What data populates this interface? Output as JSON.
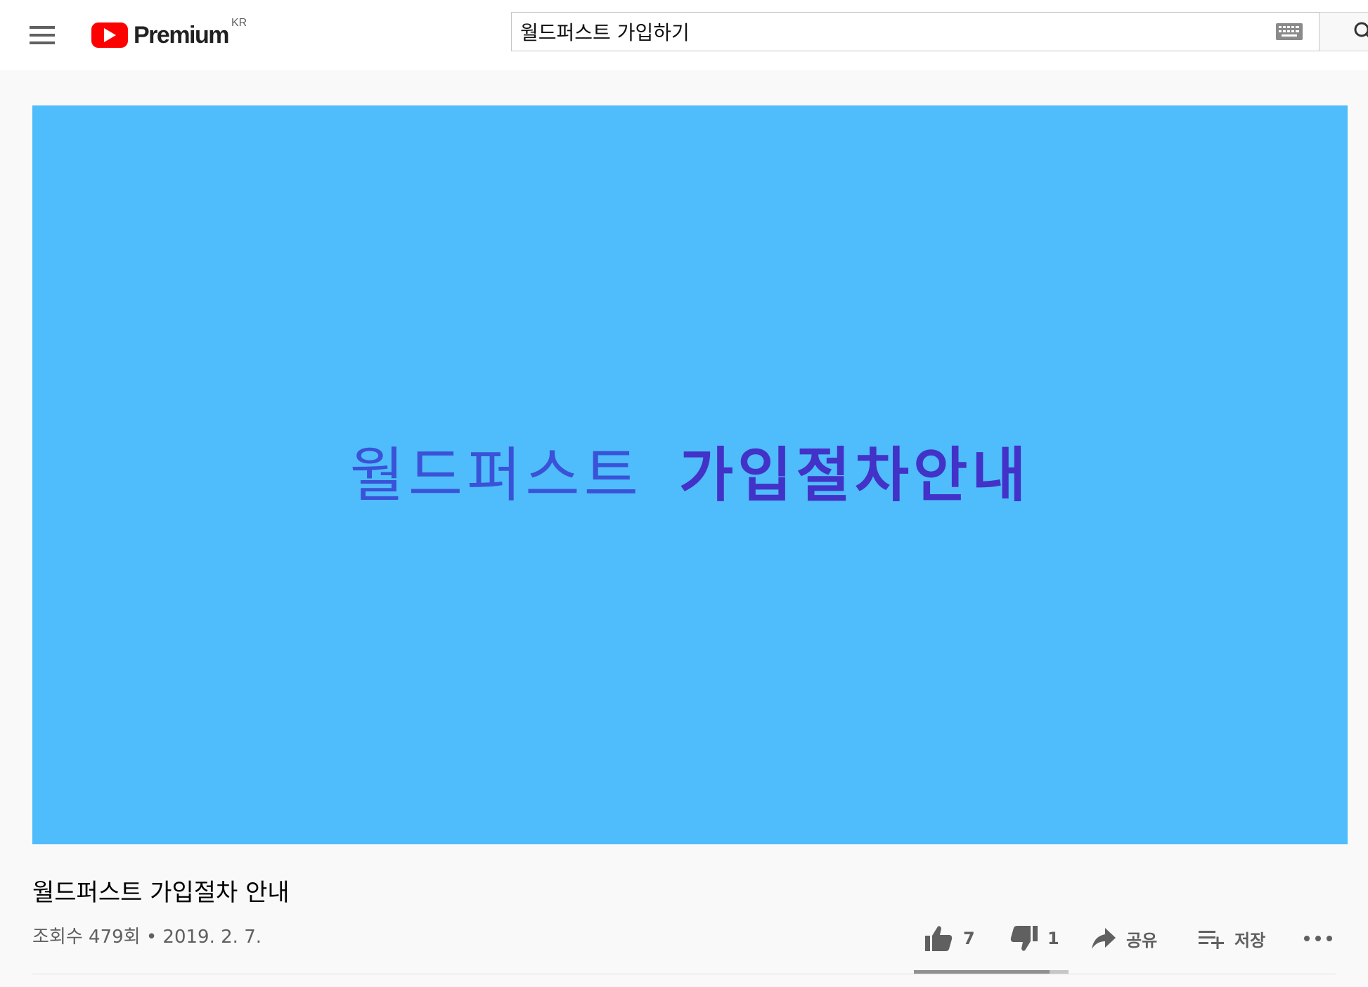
{
  "header": {
    "logo_text": "Premium",
    "region": "KR",
    "search_value": "월드퍼스트 가입하기"
  },
  "video": {
    "frame_text_part1": "월드퍼스트",
    "frame_text_part2": "가입절차안내",
    "title": "월드퍼스트 가입절차 안내",
    "view_info": "조회수 479회 • 2019. 2. 7.",
    "like_ratio": 0.875
  },
  "actions": {
    "likes": "7",
    "dislikes": "1",
    "share_label": "공유",
    "save_label": "저장"
  },
  "colors": {
    "brand_red": "#ff0000",
    "player_bg": "#4fbdfb",
    "frame_text_blue": "#3a52d8",
    "frame_text_purple": "#4232c8"
  }
}
